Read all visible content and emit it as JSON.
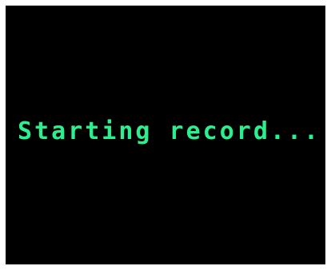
{
  "screen": {
    "status_text": "Starting record...",
    "colors": {
      "background": "#000000",
      "text": "#2cf08f"
    }
  }
}
